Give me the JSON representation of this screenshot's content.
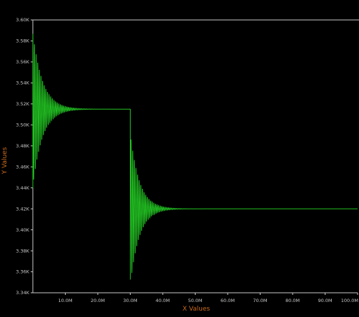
{
  "chart_data": {
    "type": "line",
    "title": "",
    "xlabel": "X Values",
    "ylabel": "Y Values",
    "xlim": [
      0,
      100000000
    ],
    "ylim": [
      3340,
      3600
    ],
    "x_ticks": [
      10000000,
      20000000,
      30000000,
      40000000,
      50000000,
      60000000,
      70000000,
      80000000,
      90000000,
      100000000
    ],
    "x_tick_labels": [
      "10.0M",
      "20.0M",
      "30.0M",
      "40.0M",
      "50.0M",
      "60.0M",
      "70.0M",
      "80.0M",
      "90.0M",
      "100.0M"
    ],
    "y_ticks": [
      3340,
      3360,
      3380,
      3400,
      3420,
      3440,
      3460,
      3480,
      3500,
      3520,
      3540,
      3560,
      3580,
      3600
    ],
    "y_tick_labels": [
      "3.34K",
      "3.36K",
      "3.38K",
      "3.40K",
      "3.42K",
      "3.44K",
      "3.46K",
      "3.48K",
      "3.50K",
      "3.52K",
      "3.54K",
      "3.56K",
      "3.58K",
      "3.60K"
    ],
    "grid": false,
    "series": [
      {
        "color": "#22c022",
        "segments": [
          {
            "x_start": 0,
            "x_end": 30000000,
            "steady": 3515,
            "initial": 3440,
            "first_peak": 3588,
            "damping_tau": 3000000,
            "oscillation_period": 500000
          },
          {
            "x_start": 30000000,
            "x_end": 100000000,
            "steady": 3420,
            "initial": 3515,
            "first_peak": 3347,
            "damping_tau": 2800000,
            "oscillation_period": 500000
          }
        ]
      }
    ]
  },
  "colors": {
    "background": "#000000",
    "axis": "#c8c8c8",
    "line": "#22c022",
    "axis_title": "#c86a1e"
  }
}
